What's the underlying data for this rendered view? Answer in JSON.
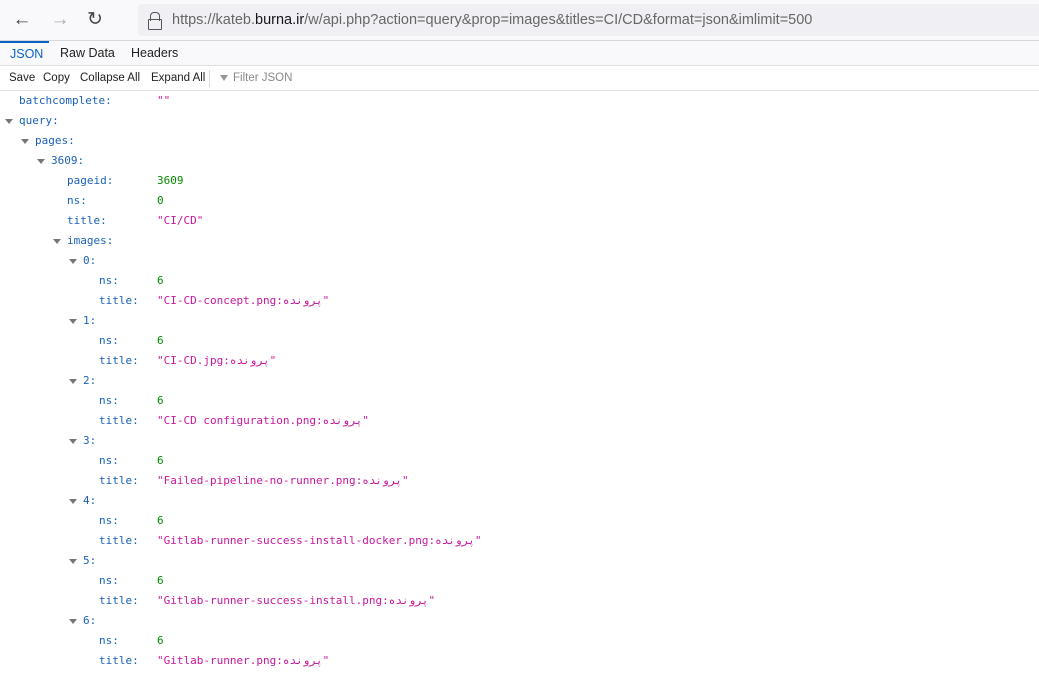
{
  "browser": {
    "url_scheme": "https://kateb.",
    "url_host": "burna.ir",
    "url_rest": "/w/api.php?action=query&prop=images&titles=CI/CD&format=json&imlimit=500"
  },
  "tabs": [
    {
      "label": "JSON"
    },
    {
      "label": "Raw Data"
    },
    {
      "label": "Headers"
    }
  ],
  "toolbar": {
    "save": "Save",
    "copy": "Copy",
    "collapse_all": "Collapse All",
    "expand_all": "Expand All",
    "filter_placeholder": "Filter JSON"
  },
  "tree": {
    "batchcomplete": "",
    "query": {
      "pages": {
        "3609": {
          "pageid": 3609,
          "ns": 0,
          "title": "CI/CD",
          "images": [
            {
              "ns": 6,
              "title": "پرونده:CI-CD-concept.png"
            },
            {
              "ns": 6,
              "title": "پرونده:CI-CD.jpg"
            },
            {
              "ns": 6,
              "title": "پرونده:CI-CD configuration.png"
            },
            {
              "ns": 6,
              "title": "پرونده:Failed-pipeline-no-runner.png"
            },
            {
              "ns": 6,
              "title": "پرونده:Gitlab-runner-success-install-docker.png"
            },
            {
              "ns": 6,
              "title": "پرونده:Gitlab-runner-success-install.png"
            },
            {
              "ns": 6,
              "title": "پرونده:Gitlab-runner.png"
            }
          ]
        }
      }
    }
  }
}
